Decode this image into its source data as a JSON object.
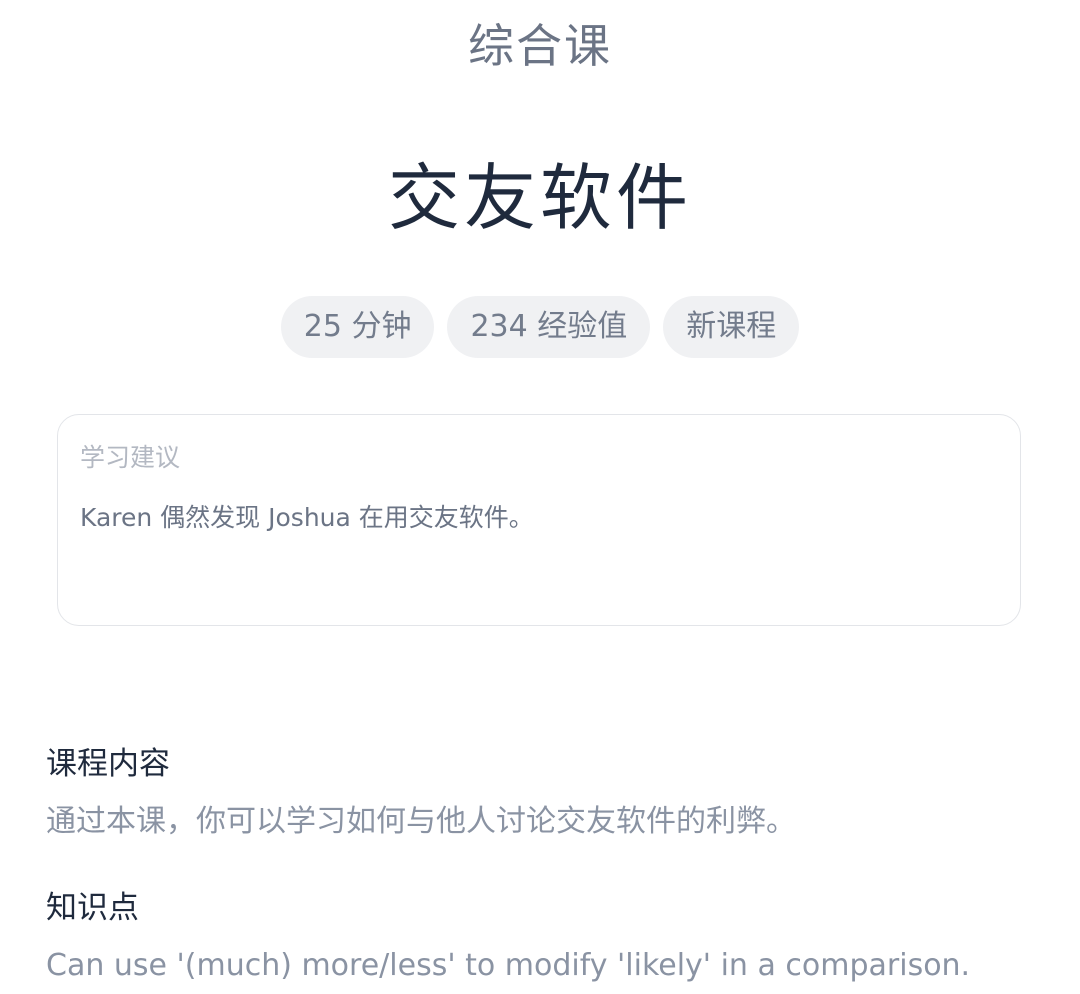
{
  "header": {
    "category": "综合课",
    "lesson_title": "交友软件"
  },
  "tags": [
    {
      "label": "25 分钟"
    },
    {
      "label": "234 经验值"
    },
    {
      "label": "新课程"
    }
  ],
  "advice": {
    "label": "学习建议",
    "text": "Karen 偶然发现 Joshua 在用交友软件。"
  },
  "course_content": {
    "heading": "课程内容",
    "text": "通过本课，你可以学习如何与他人讨论交友软件的利弊。"
  },
  "knowledge_points": {
    "heading": "知识点",
    "text": "Can use '(much) more/less' to modify 'likely' in a comparison."
  }
}
